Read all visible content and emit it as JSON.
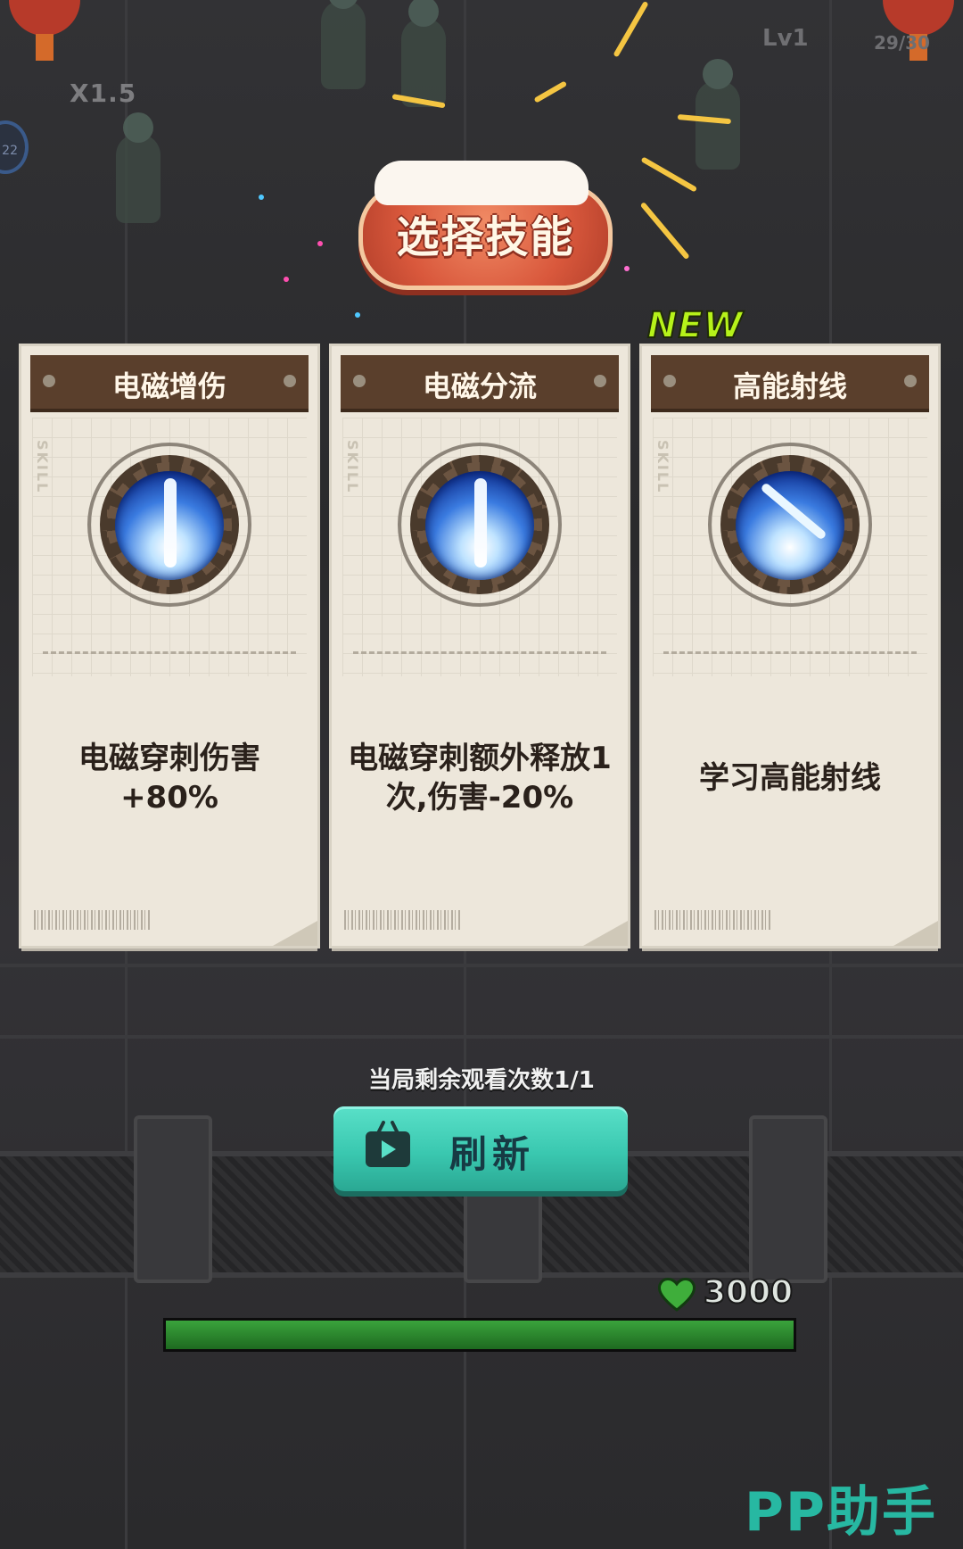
{
  "hud": {
    "speed": "X1.5",
    "level": "Lv1",
    "ammo": "29/30",
    "side_badge": "22",
    "hp_value": "3000",
    "hp_fraction": 1.0
  },
  "dialog": {
    "title": "选择技能",
    "new_badge": "NEW",
    "cards": [
      {
        "tag": "SKILL",
        "name": "电磁增伤",
        "icon": "lightning-strike-icon",
        "description": "电磁穿刺伤害+80%"
      },
      {
        "tag": "SKILL",
        "name": "电磁分流",
        "icon": "lightning-strike-icon",
        "description": "电磁穿刺额外释放1次,伤害-20%"
      },
      {
        "tag": "SKILL",
        "name": "高能射线",
        "icon": "energy-beam-icon",
        "description": "学习高能射线"
      }
    ],
    "remaining_views": "当局剩余观看次数1/1",
    "refresh_label": "刷新",
    "refresh_icon": "tv-video-icon"
  },
  "watermark": "PP助手"
}
